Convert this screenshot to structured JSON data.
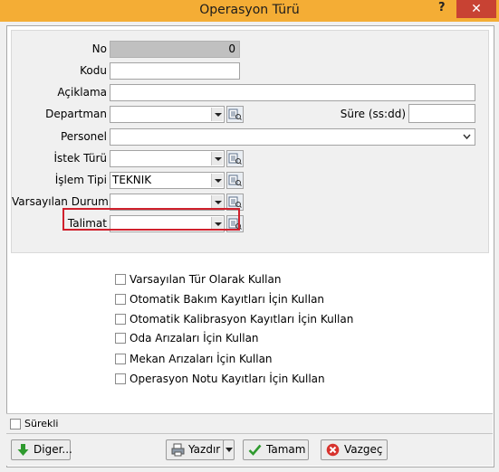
{
  "window": {
    "title": "Operasyon Türü",
    "help_glyph": "?",
    "close_glyph": "✕"
  },
  "form": {
    "no": {
      "label": "No",
      "value": "0"
    },
    "kodu": {
      "label": "Kodu",
      "value": ""
    },
    "aciklama": {
      "label": "Açiklama",
      "value": ""
    },
    "departman": {
      "label": "Departman",
      "value": ""
    },
    "sure": {
      "label": "Süre (ss:dd)",
      "value": ""
    },
    "personel": {
      "label": "Personel",
      "value": ""
    },
    "istek_turu": {
      "label": "İstek Türü",
      "value": ""
    },
    "islem_tipi": {
      "label": "İşlem Tipi",
      "value": "TEKNIK"
    },
    "varsayilan_durum": {
      "label": "Varsayılan Durum",
      "value": ""
    },
    "talimat": {
      "label": "Talimat",
      "value": ""
    }
  },
  "options": [
    {
      "label": "Varsayılan Tür Olarak Kullan",
      "checked": false
    },
    {
      "label": "Otomatik Bakım Kayıtları İçin Kullan",
      "checked": false
    },
    {
      "label": "Otomatik Kalibrasyon Kayıtları İçin Kullan",
      "checked": false
    },
    {
      "label": "Oda Arızaları İçin Kullan",
      "checked": false
    },
    {
      "label": "Mekan Arızaları İçin Kullan",
      "checked": false
    },
    {
      "label": "Operasyon Notu Kayıtları İçin Kullan",
      "checked": false
    }
  ],
  "footer": {
    "surekli": {
      "label": "Sürekli",
      "checked": false
    },
    "buttons": {
      "diger": "Diger...",
      "yazdir": "Yazdır",
      "tamam": "Tamam",
      "vazgec": "Vazgeç"
    }
  },
  "colors": {
    "titlebar": "#f4ad35",
    "close": "#c84233",
    "highlight": "#d0202c"
  },
  "icons": {
    "lookup": "lookup-icon",
    "diger": "arrow-down-icon",
    "yazdir": "print-icon",
    "tamam": "check-icon",
    "vazgec": "cancel-icon"
  }
}
